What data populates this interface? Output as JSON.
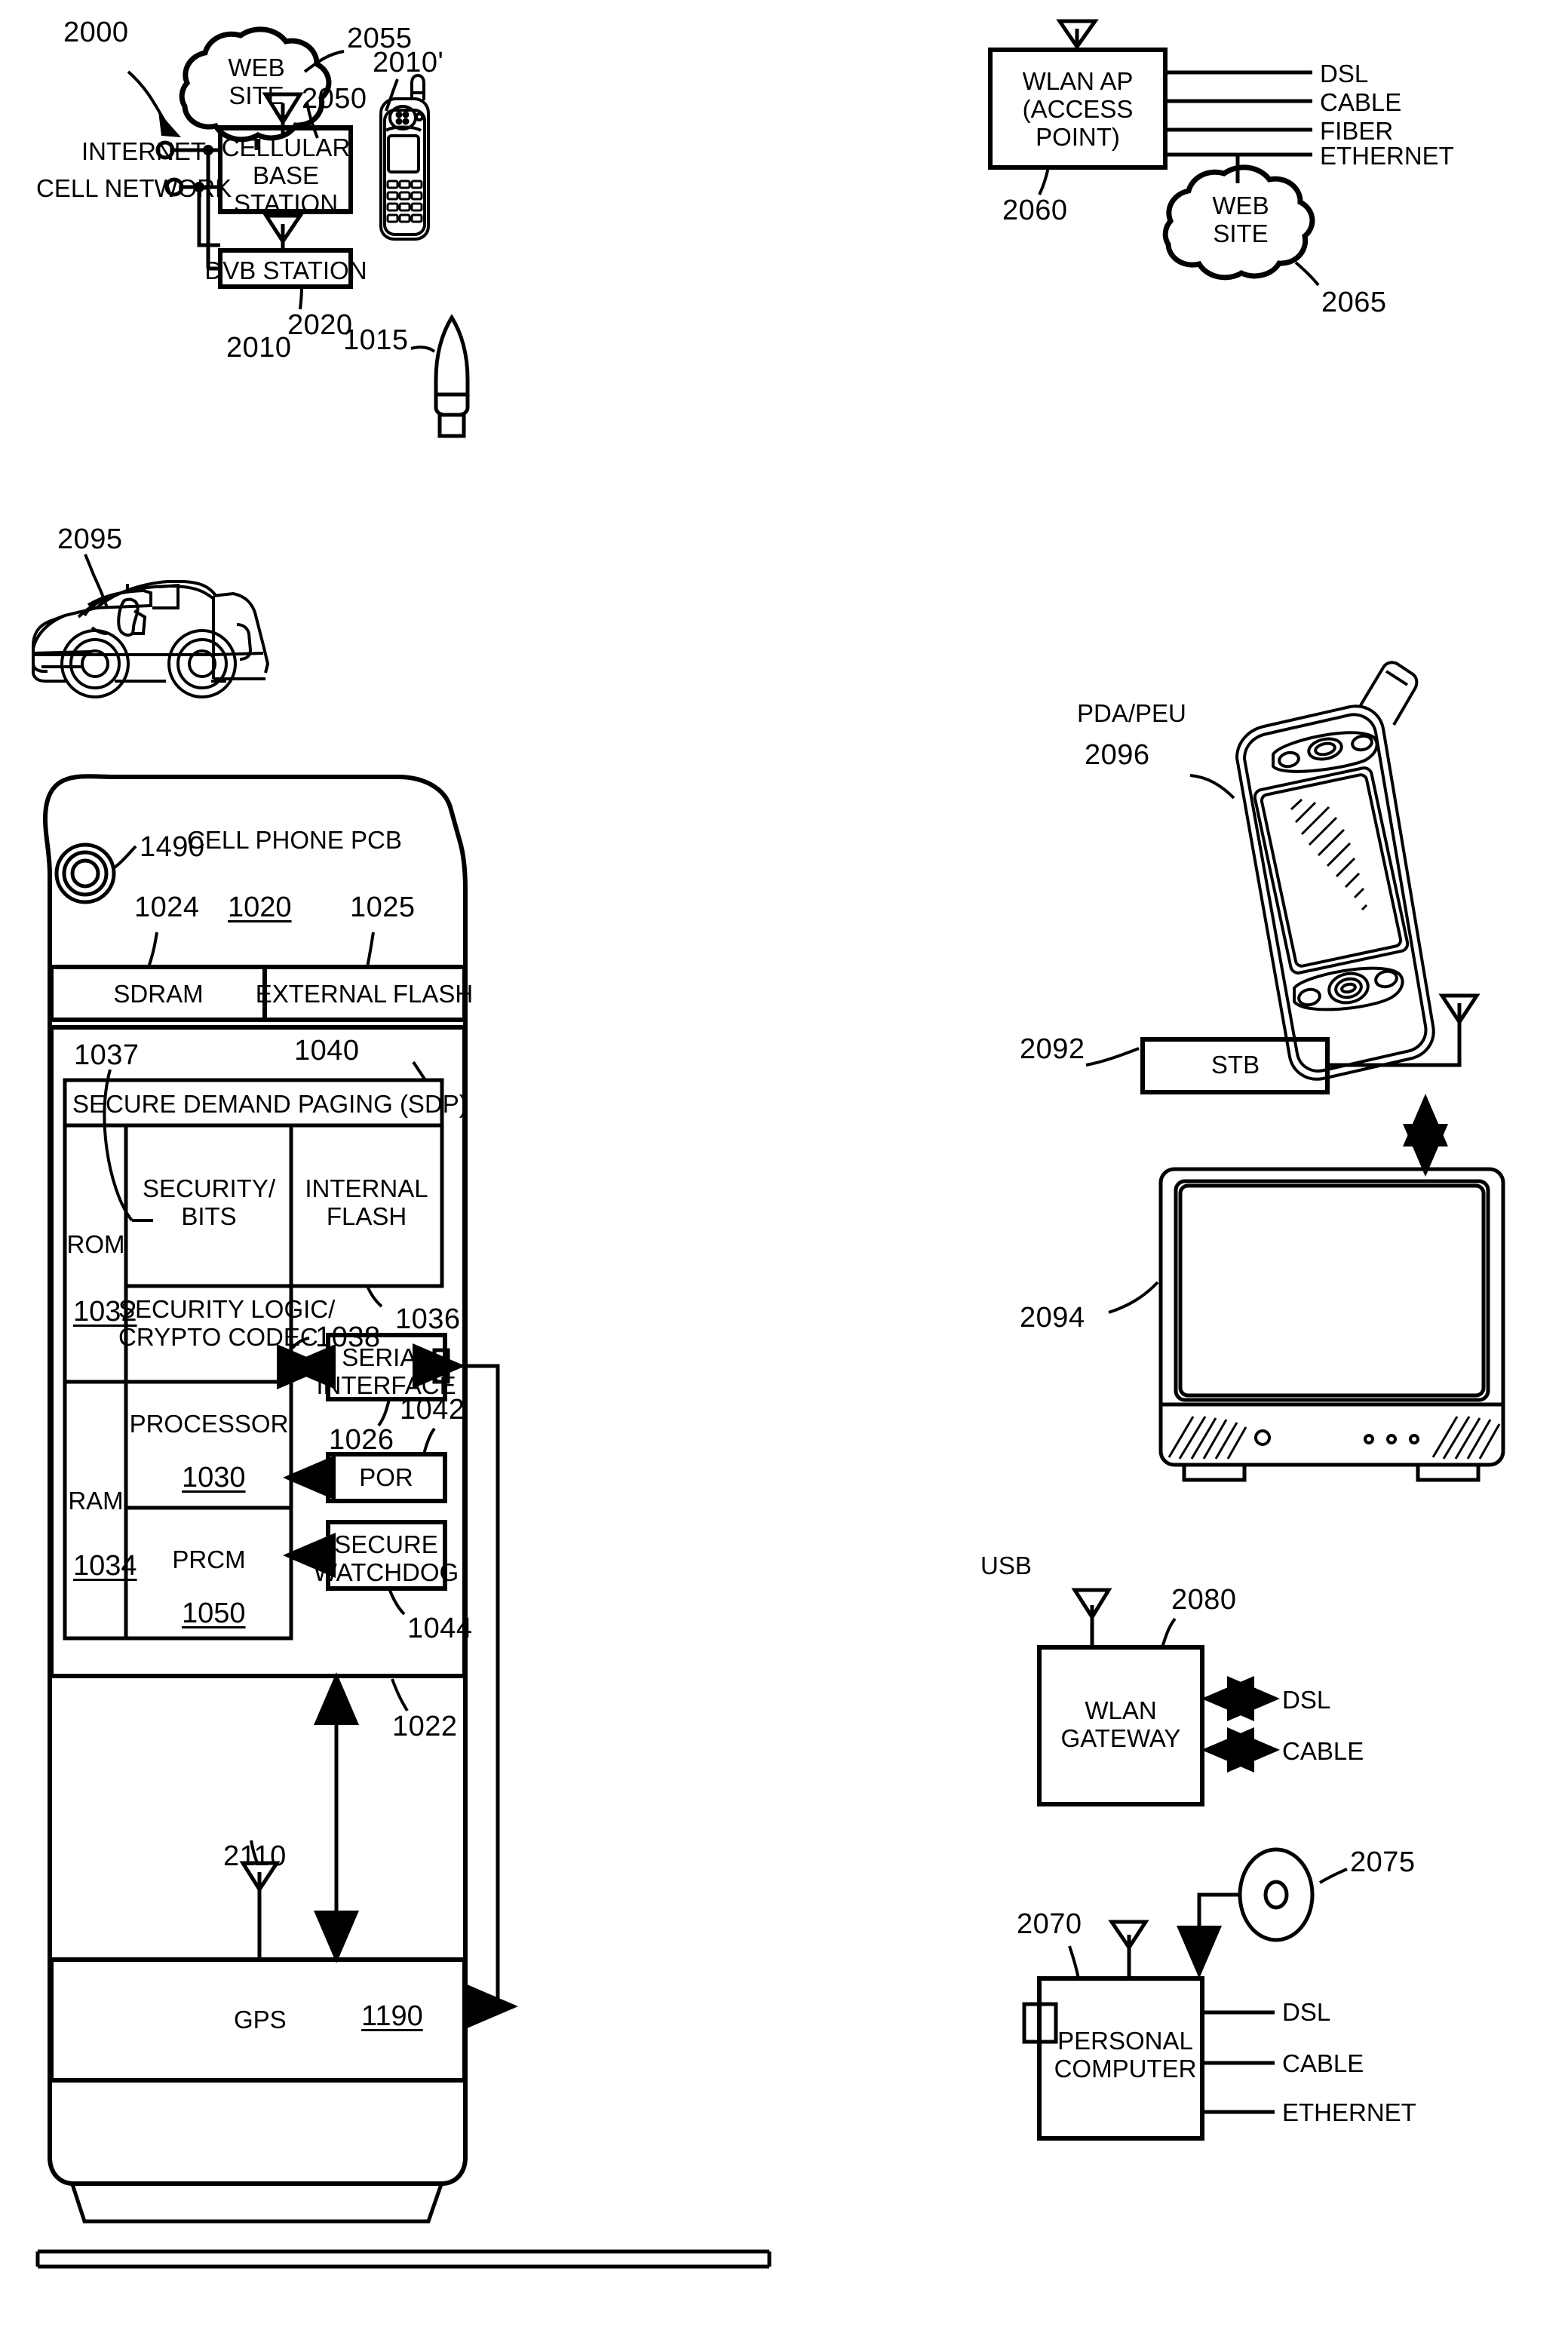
{
  "figure": {
    "main_ref": "2000"
  },
  "nodes": {
    "web_site_top": {
      "label": "WEB\nSITE",
      "ref": "2055"
    },
    "cellular_base_station": {
      "label": "CELLULAR\nBASE\nSTATION",
      "ref": "2050"
    },
    "dvb_station": {
      "label": "DVB STATION",
      "ref": "2020"
    },
    "handset_alt": {
      "ref": "2010'"
    },
    "wlan_ap": {
      "label": "WLAN AP\n(ACCESS\nPOINT)",
      "ref": "2060"
    },
    "web_site_right": {
      "label": "WEB\nSITE",
      "ref": "2065"
    },
    "car": {
      "ref": "2095"
    },
    "pda": {
      "label": "PDA/PEU",
      "ref": "2096"
    },
    "stb": {
      "label": "STB",
      "ref": "2092"
    },
    "tv": {
      "ref": "2094"
    },
    "wlan_gateway": {
      "label": "WLAN\nGATEWAY",
      "ref": "2080"
    },
    "personal_computer": {
      "label": "PERSONAL\nCOMPUTER",
      "ref": "2070"
    },
    "disc_media": {
      "ref": "2075"
    },
    "cellphone_pcb": {
      "label": "CELL PHONE PCB",
      "ref": "2010",
      "pcb_ref": "1020"
    },
    "antenna_1015": {
      "ref": "1015"
    },
    "speaker_1490": {
      "ref": "1490"
    },
    "sdram": {
      "label": "SDRAM",
      "ref": "1024"
    },
    "external_flash": {
      "label": "EXTERNAL FLASH",
      "ref": "1025"
    },
    "sdp": {
      "label": "SECURE DEMAND PAGING (SDP)",
      "ref": "1040"
    },
    "rom": {
      "label": "ROM",
      "ref": "1032"
    },
    "ram": {
      "label": "RAM",
      "ref": "1034"
    },
    "security_bits": {
      "label": "SECURITY/\nBITS",
      "ref": "1037"
    },
    "internal_flash": {
      "label": "INTERNAL\nFLASH",
      "ref": "1036"
    },
    "security_logic": {
      "label": "SECURITY LOGIC/\nCRYPTO CODEC",
      "ref": "1038"
    },
    "processor": {
      "label": "PROCESSOR",
      "ref": "1030"
    },
    "prcm": {
      "label": "PRCM",
      "ref": "1050"
    },
    "serial_interface": {
      "label": "SERIAL\nINTERFACE",
      "ref": "1026"
    },
    "por": {
      "label": "POR",
      "ref": "1042"
    },
    "secure_watchdog": {
      "label": "SECURE\nWATCHDOG",
      "ref": "1044"
    },
    "chip_outline": {
      "ref": "1022"
    },
    "gps": {
      "label": "GPS",
      "ref": "1190"
    },
    "gps_link": {
      "ref": "2110"
    }
  },
  "net_labels": {
    "internet": "INTERNET",
    "cell_network": "CELL NETWORK",
    "usb": "USB",
    "wlan_ap_links": [
      "DSL",
      "CABLE",
      "FIBER",
      "ETHERNET"
    ],
    "gateway_links": [
      "DSL",
      "CABLE"
    ],
    "pc_links": [
      "DSL",
      "CABLE",
      "ETHERNET"
    ]
  },
  "colors": {
    "stroke": "#000000",
    "background": "#ffffff"
  }
}
